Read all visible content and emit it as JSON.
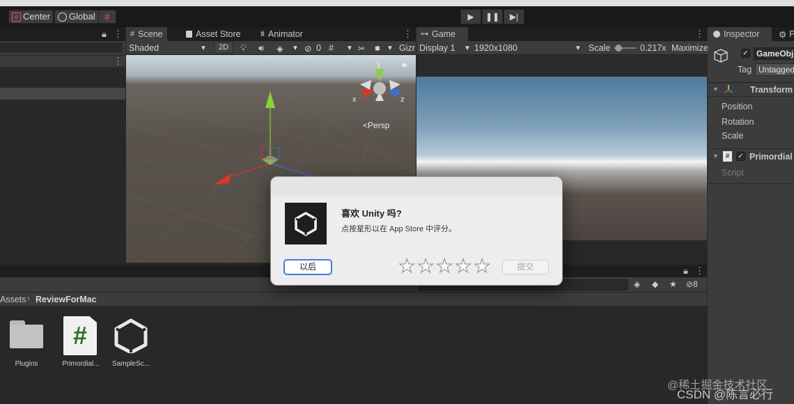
{
  "toolbar": {
    "pivot_label": "Center",
    "space_label": "Global"
  },
  "scene_tabs": [
    {
      "label": "Scene"
    },
    {
      "label": "Asset Store"
    },
    {
      "label": "Animator"
    }
  ],
  "scene_bar": {
    "shading": "Shaded",
    "mode_2d": "2D",
    "hidden_count": "0",
    "gizmos": "Gizr"
  },
  "scene_view": {
    "persp_label": "Persp",
    "axis_y": "y",
    "axis_x": "x",
    "axis_z": "z"
  },
  "game_tab": {
    "label": "Game"
  },
  "game_bar": {
    "display": "Display 1",
    "resolution": "1920x1080",
    "scale_label": "Scale",
    "scale_value": "0.217x",
    "maximize": "Maximize"
  },
  "inspector": {
    "tab_label": "Inspector",
    "tab2_label": "P",
    "object_name": "GameObj",
    "tag_label": "Tag",
    "tag_value": "Untagged",
    "transform_label": "Transform",
    "position_label": "Position",
    "rotation_label": "Rotation",
    "scale_label": "Scale",
    "script_component": "Primordial",
    "script_field": "Script"
  },
  "project": {
    "breadcrumb_root": "Assets",
    "breadcrumb_folder": "ReviewForMac",
    "hidden_count": "8",
    "assets": [
      {
        "name": "Plugins",
        "icon": "folder-icon"
      },
      {
        "name": "Primordial...",
        "icon": "csharp-script-icon"
      },
      {
        "name": "SampleSc...",
        "icon": "unity-scene-icon"
      }
    ]
  },
  "dialog": {
    "title": "喜欢 Unity 吗?",
    "message": "点按星形以在 App Store 中评分。",
    "later_button": "以后",
    "submit_button": "提交",
    "rating": 0,
    "max_rating": 5
  },
  "watermark": {
    "line1": "@稀土掘金技术社区",
    "line2": "CSDN @陈言必行"
  },
  "colors": {
    "accent_blue": "#3b7fd9",
    "axis_x_red": "#d8362a",
    "axis_y_green": "#8bd13b",
    "axis_z_blue": "#3a6fd8"
  }
}
